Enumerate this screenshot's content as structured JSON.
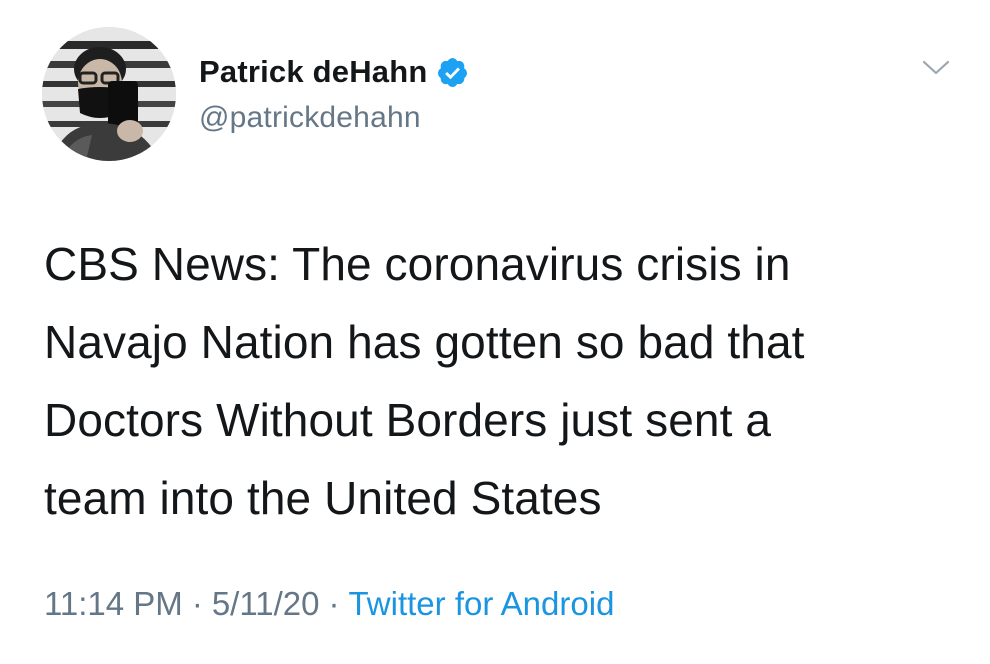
{
  "user": {
    "display_name": "Patrick deHahn",
    "handle": "@patrickdehahn",
    "verified": true,
    "avatar_icon": "profile-photo"
  },
  "tweet": {
    "text_lines": [
      "CBS News: The coronavirus crisis in",
      "Navajo Nation has gotten so bad that",
      "Doctors Without Borders just sent a",
      "team into the United States"
    ],
    "time": "11:14 PM",
    "separator": "·",
    "date": "5/11/20",
    "source": "Twitter for Android"
  },
  "icons": {
    "verified": "verified-badge-icon",
    "caret": "chevron-down-icon"
  },
  "colors": {
    "text": "#14171a",
    "secondary": "#657786",
    "link": "#1b95e0",
    "verified": "#1da1f2"
  }
}
